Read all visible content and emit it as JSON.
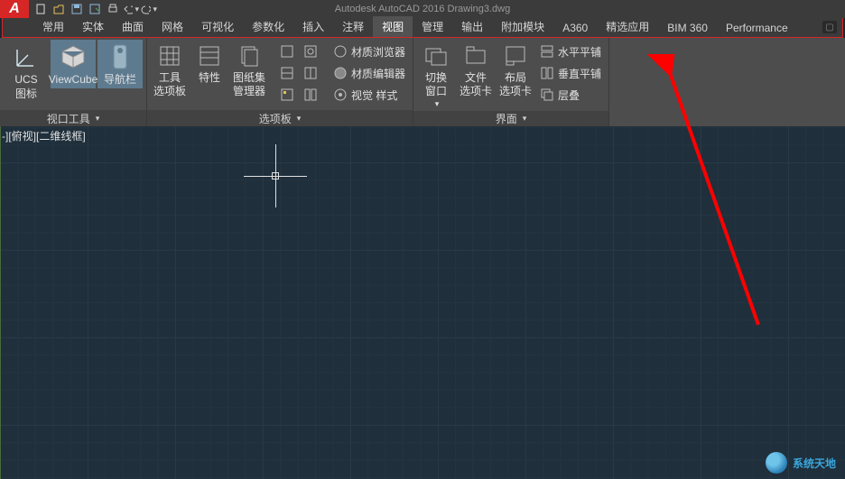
{
  "title": "Autodesk AutoCAD 2016    Drawing3.dwg",
  "app_icon_text": "A",
  "tabs": {
    "items": [
      {
        "label": "常用"
      },
      {
        "label": "实体"
      },
      {
        "label": "曲面"
      },
      {
        "label": "网格"
      },
      {
        "label": "可视化"
      },
      {
        "label": "参数化"
      },
      {
        "label": "插入"
      },
      {
        "label": "注释"
      },
      {
        "label": "视图"
      },
      {
        "label": "管理"
      },
      {
        "label": "输出"
      },
      {
        "label": "附加模块"
      },
      {
        "label": "A360"
      },
      {
        "label": "精选应用"
      },
      {
        "label": "BIM 360"
      },
      {
        "label": "Performance"
      }
    ],
    "active_index": 8
  },
  "ribbon": {
    "panel_vtools": {
      "title": "视口工具",
      "ucs": {
        "label": "UCS",
        "sub": "图标"
      },
      "viewcube": {
        "label": "ViewCube"
      },
      "navbar": {
        "label": "导航栏"
      }
    },
    "panel_palettes": {
      "title": "选项板",
      "tool": {
        "label": "工具",
        "sub": "选项板"
      },
      "props": {
        "label": "特性"
      },
      "sheets": {
        "label": "图纸集",
        "sub": "管理器"
      },
      "mat_browser": "材质浏览器",
      "mat_editor": "材质编辑器",
      "vis_style": "视觉 样式"
    },
    "panel_interface": {
      "title": "界面",
      "switch": {
        "label": "切换",
        "sub": "窗口"
      },
      "file": {
        "label": "文件",
        "sub": "选项卡"
      },
      "layout": {
        "label": "布局",
        "sub": "选项卡"
      },
      "htile": "水平平铺",
      "vtile": "垂直平铺",
      "cascade": "层叠"
    }
  },
  "view_label": "-][俯视][二维线框]",
  "watermark": "系统天地"
}
